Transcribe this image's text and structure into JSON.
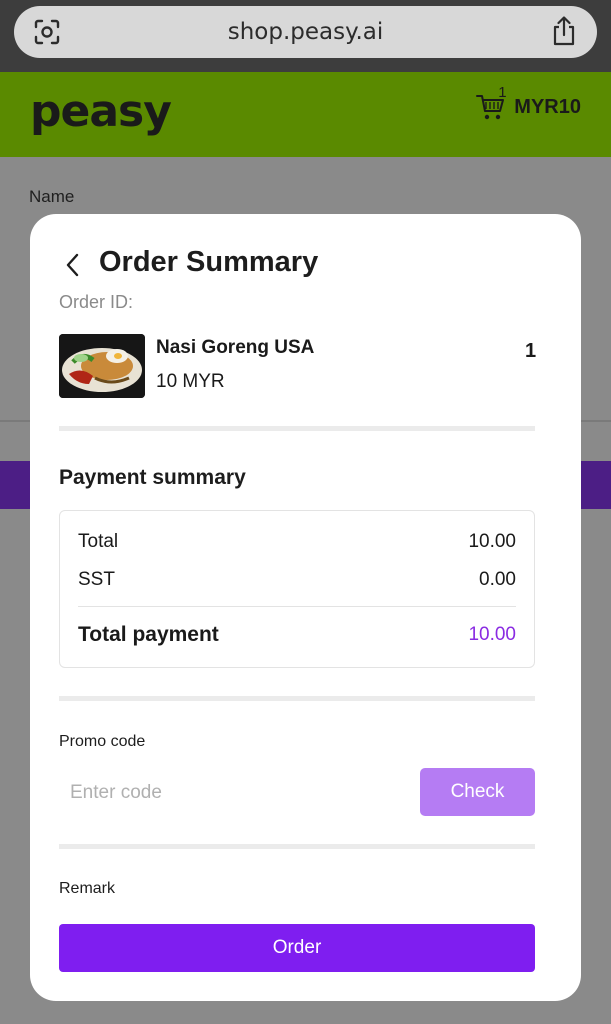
{
  "browser": {
    "url": "shop.peasy.ai",
    "lens_icon": "lens-icon",
    "share_icon": "share-icon"
  },
  "header": {
    "logo_text": "peasy",
    "cart_count": "1",
    "cart_total": "MYR10",
    "cart_icon": "cart-icon",
    "brand_color": "#5a8a00"
  },
  "background_page": {
    "name_label": "Name"
  },
  "modal": {
    "title": "Order Summary",
    "order_id_label": "Order ID:",
    "items": [
      {
        "name": "Nasi Goreng USA",
        "price": "10 MYR",
        "quantity": "1"
      }
    ],
    "payment": {
      "heading": "Payment summary",
      "total_label": "Total",
      "total_value": "10.00",
      "sst_label": "SST",
      "sst_value": "0.00",
      "total_payment_label": "Total payment",
      "total_payment_value": "10.00"
    },
    "promo": {
      "label": "Promo code",
      "placeholder": "Enter code",
      "check_label": "Check"
    },
    "remark_label": "Remark",
    "order_label": "Order",
    "accent_color": "#7f1ef0"
  }
}
